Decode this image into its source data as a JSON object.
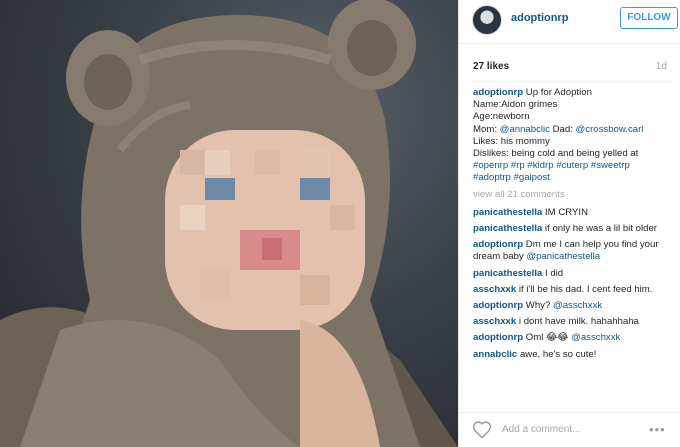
{
  "header": {
    "username": "adoptionrp",
    "follow_label": "FOLLOW"
  },
  "meta": {
    "likes": "27 likes",
    "time": "1d"
  },
  "caption": {
    "user": "adoptionrp",
    "line1": "Up for Adoption",
    "line2": "Name:Aidon grimes",
    "line3": "Age:newborn",
    "mom_label": "Mom:",
    "mom_tag": "@annabclic",
    "dad_label": "Dad:",
    "dad_tag": "@crossbow.carl",
    "likes_line": "Likes: his mommy",
    "dislikes_line": "Dislikes: being cold and being yelled at",
    "hashtags1": "#openrp #rp #kidrp #cuterp #sweetrp",
    "hashtags2": "#adoptrp #gaipost"
  },
  "view_all": "view all 21 comments",
  "comments": [
    {
      "user": "panicathestella",
      "text": "IM CRYIN"
    },
    {
      "user": "panicathestella",
      "text": "if only he was a lil bit older"
    },
    {
      "user": "adoptionrp",
      "text": "Dm me I can help you find your dream baby",
      "tag": "@panicathestella"
    },
    {
      "user": "panicathestella",
      "text": "I did"
    },
    {
      "user": "asschxxk",
      "text": "if i'll be his dad. I cent feed him."
    },
    {
      "user": "adoptionrp",
      "text": "Why?",
      "tag": "@asschxxk"
    },
    {
      "user": "asschxxk",
      "text": "i dont have milk. hahahhaha"
    },
    {
      "user": "adoptionrp",
      "text": "Oml 😂😂",
      "tag": "@asschxxk"
    },
    {
      "user": "annabclic",
      "text": "awe, he's so cute!"
    }
  ],
  "add_comment_placeholder": "Add a comment...",
  "more_glyph": "•••",
  "colors": {
    "link": "#125688",
    "follow": "#3897f0",
    "muted": "#a5a7aa"
  },
  "icons": {
    "like": "heart-icon",
    "more": "more-options-icon"
  }
}
